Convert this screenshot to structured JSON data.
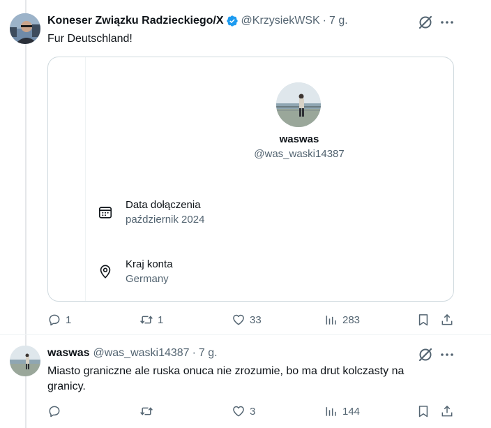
{
  "tweet1": {
    "name": "Koneser Związku Radzieckiego/X",
    "handle": "@KrzysiekWSK",
    "time": "7 g.",
    "text": "Fur Deutschland!",
    "card": {
      "username": "waswas",
      "handle": "@was_waski14387",
      "joined_label": "Data dołączenia",
      "joined_value": "październik 2024",
      "country_label": "Kraj konta",
      "country_value": "Germany"
    },
    "actions": {
      "replies": "1",
      "reposts": "1",
      "likes": "33",
      "views": "283"
    }
  },
  "tweet2": {
    "name": "waswas",
    "handle": "@was_waski14387",
    "time": "7 g.",
    "text_line1": "Miasto graniczne ale ruska onuca nie zrozumie, bo ma drut kolczasty na",
    "text_line2": "granicy.",
    "actions": {
      "replies": "",
      "reposts": "",
      "likes": "3",
      "views": "144"
    }
  },
  "colors": {
    "text": "#0f1419",
    "muted": "#536471",
    "verified": "#1d9bf0",
    "border": "#cfd9de"
  },
  "icons": [
    "verified-badge-icon",
    "grok-icon",
    "more-icon",
    "calendar-icon",
    "location-icon",
    "reply-icon",
    "repost-icon",
    "like-icon",
    "views-icon",
    "bookmark-icon",
    "share-icon"
  ]
}
